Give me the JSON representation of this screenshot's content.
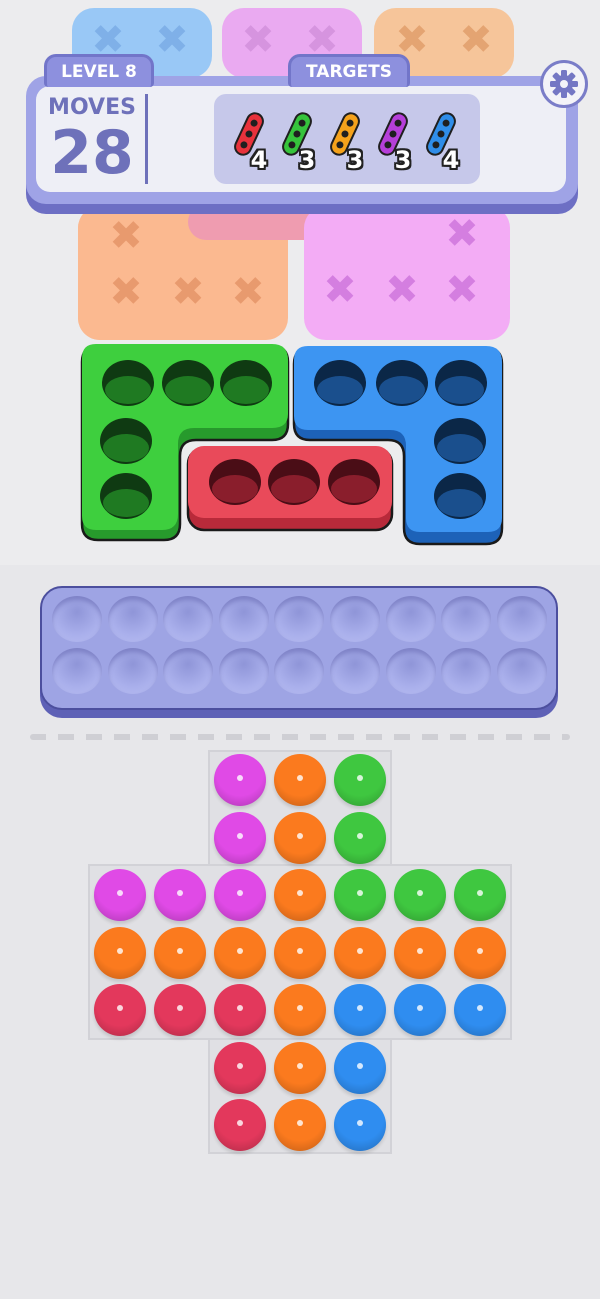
{
  "hud": {
    "level_label": "LEVEL 8",
    "targets_label": "TARGETS",
    "moves_label": "MOVES",
    "moves_value": "28",
    "settings_icon": "gear-icon"
  },
  "targets": [
    {
      "color": "#e8323c",
      "count": "4"
    },
    {
      "color": "#36c43c",
      "count": "3"
    },
    {
      "color": "#f5a21b",
      "count": "3"
    },
    {
      "color": "#b53fd9",
      "count": "3"
    },
    {
      "color": "#2f8de8",
      "count": "4"
    }
  ],
  "palette": {
    "magenta": "#e04ae6",
    "orange": "#fb7a1e",
    "green": "#3fc740",
    "red": "#e3385c",
    "blue": "#2f8df0",
    "tray": "#9ea4e4"
  },
  "tray": {
    "rows": 2,
    "cols": 9,
    "icon": "empty-slot"
  },
  "ball_grid": [
    [
      "",
      "",
      "magenta",
      "orange",
      "green",
      "",
      ""
    ],
    [
      "",
      "",
      "magenta",
      "orange",
      "green",
      "",
      ""
    ],
    [
      "magenta",
      "magenta",
      "magenta",
      "orange",
      "green",
      "green",
      "green"
    ],
    [
      "orange",
      "orange",
      "orange",
      "orange",
      "orange",
      "orange",
      "orange"
    ],
    [
      "red",
      "red",
      "red",
      "orange",
      "blue",
      "blue",
      "blue"
    ],
    [
      "",
      "",
      "red",
      "orange",
      "blue",
      "",
      ""
    ],
    [
      "",
      "",
      "red",
      "orange",
      "blue",
      "",
      ""
    ]
  ],
  "active_pieces": [
    {
      "name": "green-L-piece",
      "color": "#3ecf3e",
      "holes": 5
    },
    {
      "name": "blue-L-piece",
      "color": "#3d95f2",
      "holes": 5
    },
    {
      "name": "red-bar-piece",
      "color": "#e94a5a",
      "holes": 3
    }
  ]
}
